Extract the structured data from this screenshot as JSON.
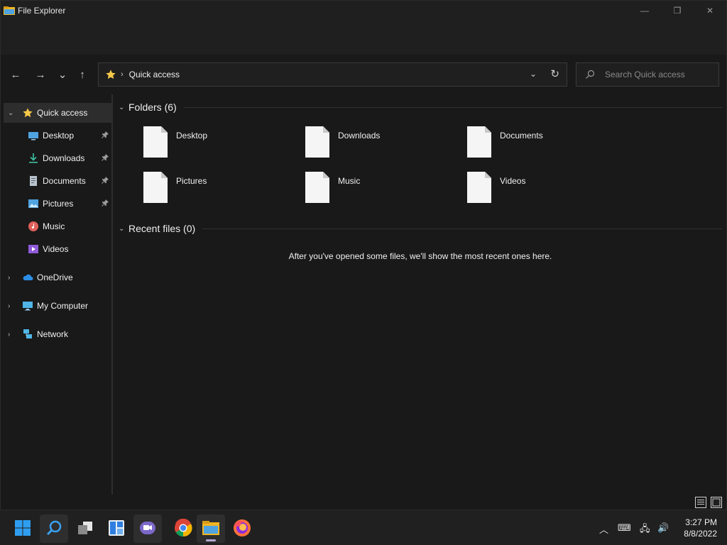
{
  "window": {
    "title": "File Explorer",
    "controls": {
      "minimize": "—",
      "restore": "❐",
      "close": "✕"
    }
  },
  "toolbar": {
    "back": "←",
    "forward": "→",
    "recent": "⌄",
    "up": "↑"
  },
  "address": {
    "path": "Quick access",
    "separator": "›",
    "dropdown": "⌄",
    "refresh": "↻"
  },
  "search": {
    "placeholder": "Search Quick access"
  },
  "sidebar": {
    "items": [
      {
        "label": "Quick access",
        "icon": "star-icon",
        "expanded": true,
        "selected": true
      },
      {
        "label": "Desktop",
        "icon": "desktop-icon",
        "pinned": true
      },
      {
        "label": "Downloads",
        "icon": "download-icon",
        "pinned": true
      },
      {
        "label": "Documents",
        "icon": "document-icon",
        "pinned": true
      },
      {
        "label": "Pictures",
        "icon": "pictures-icon",
        "pinned": true
      },
      {
        "label": "Music",
        "icon": "music-icon"
      },
      {
        "label": "Videos",
        "icon": "videos-icon"
      },
      {
        "label": "OneDrive",
        "icon": "onedrive-icon",
        "expanded": false
      },
      {
        "label": "My Computer",
        "icon": "computer-icon",
        "expanded": false
      },
      {
        "label": "Network",
        "icon": "network-icon",
        "expanded": false
      }
    ],
    "pin_glyph": "📌",
    "chev_open": "⌄",
    "chev_closed": "›"
  },
  "content": {
    "folders_header": "Folders (6)",
    "folders": [
      "Desktop",
      "Downloads",
      "Documents",
      "Pictures",
      "Music",
      "Videos"
    ],
    "recent_header": "Recent files (0)",
    "recent_empty": "After you've opened some files, we'll show the most recent ones here."
  },
  "taskbar": {
    "apps": [
      "start-icon",
      "search-icon",
      "task-view-icon",
      "widgets-icon",
      "chat-icon",
      "chrome-icon",
      "file-explorer-icon",
      "firefox-icon"
    ],
    "time": "3:27 PM",
    "date": "8/8/2022",
    "tray": {
      "chevron": "︿",
      "keyboard": "⌨",
      "network": "🖧",
      "volume": "🔊"
    }
  },
  "colors": {
    "accent": "#f7c948",
    "background": "#191919",
    "taskbar": "#202020"
  }
}
